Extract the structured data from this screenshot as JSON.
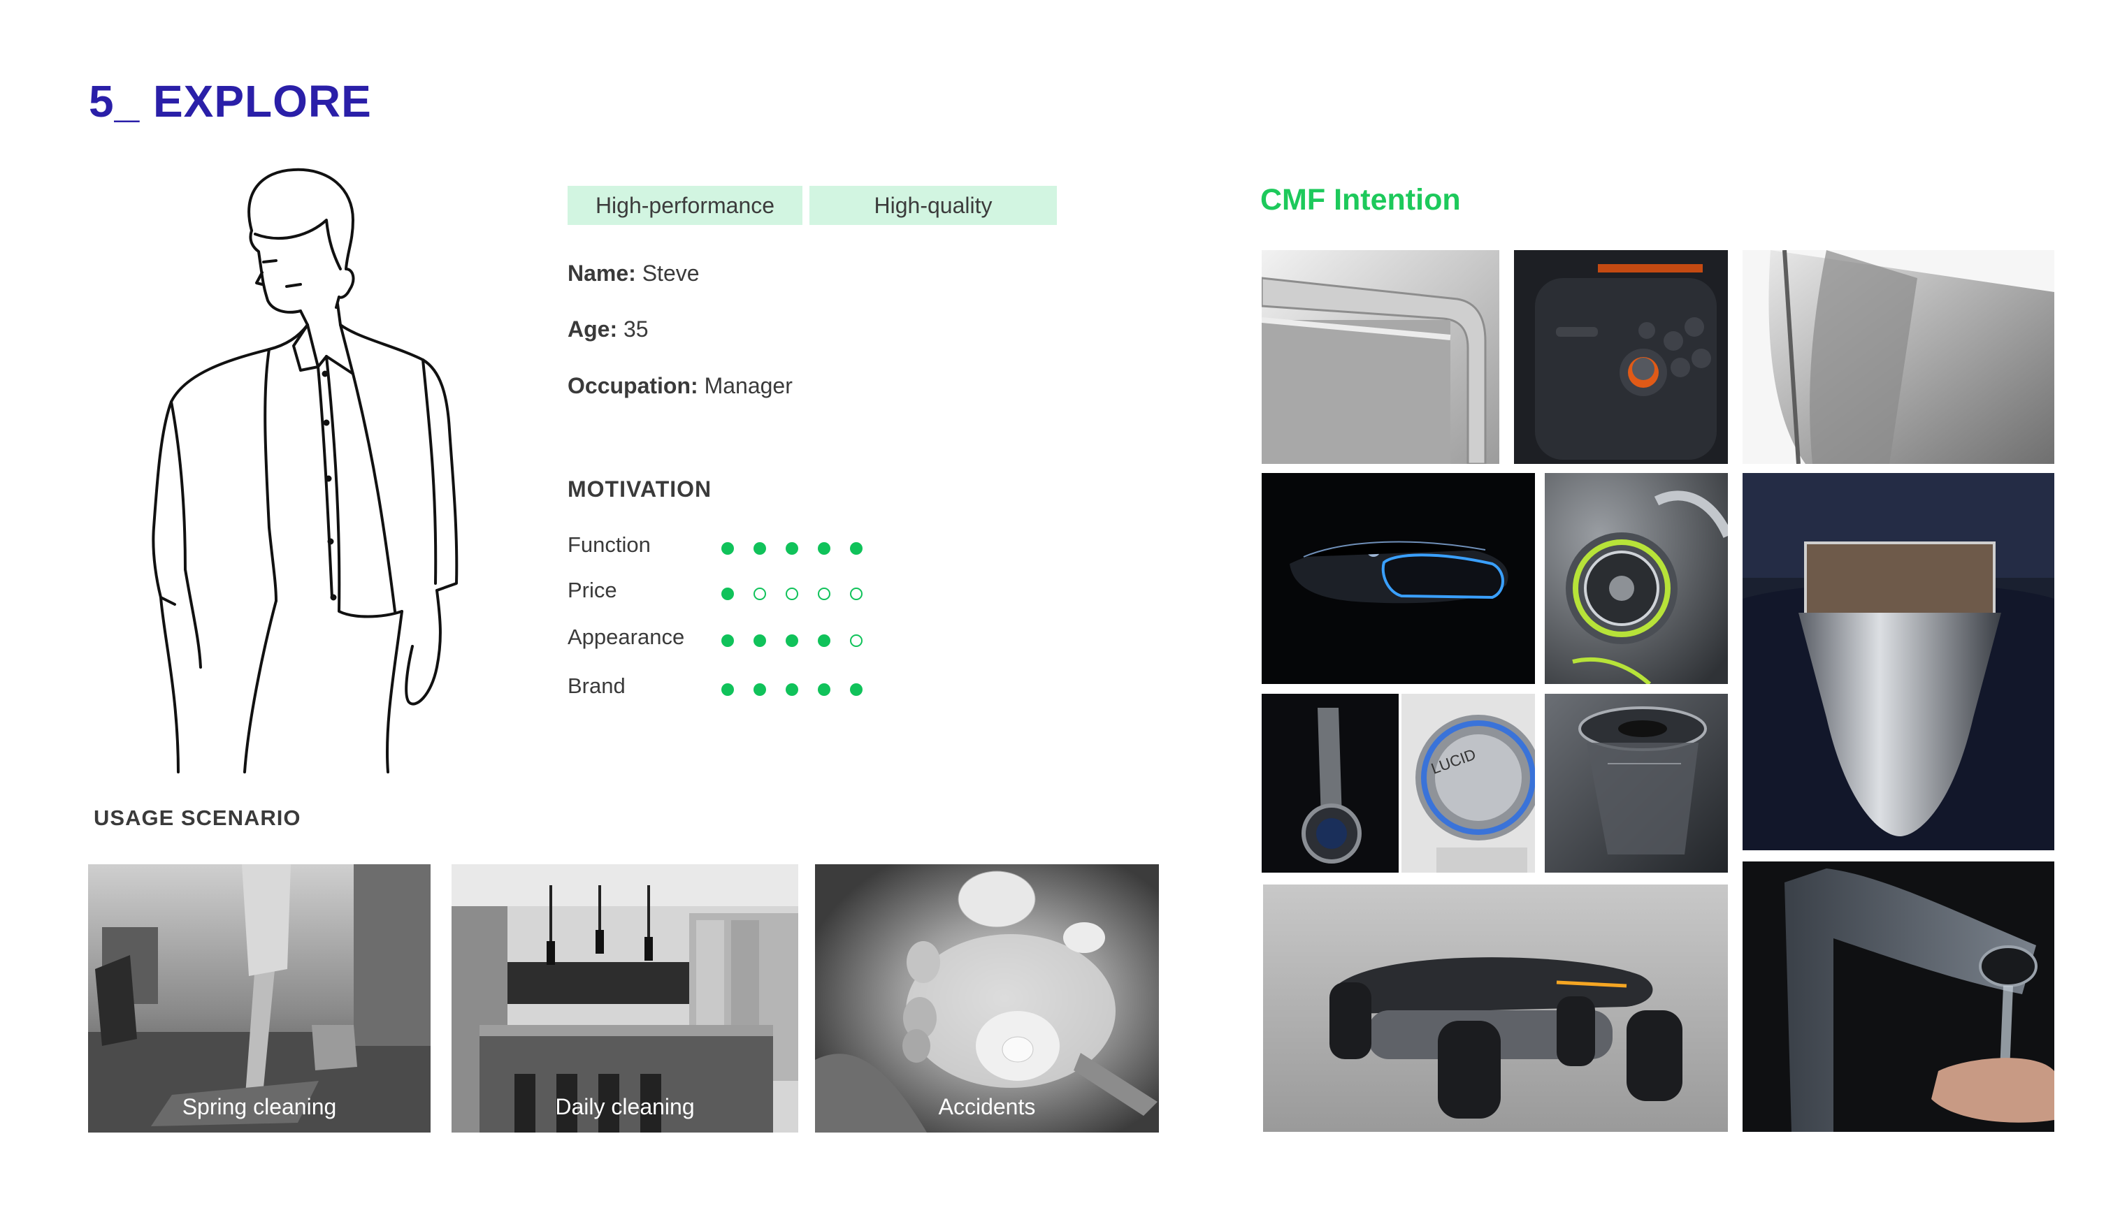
{
  "header": {
    "title": "5_ EXPLORE"
  },
  "persona": {
    "tags": [
      "High-performance",
      "High-quality"
    ],
    "name_label": "Name:",
    "name_value": "Steve",
    "age_label": "Age:",
    "age_value": "35",
    "occupation_label": "Occupation:",
    "occupation_value": "Manager"
  },
  "motivation": {
    "title": "MOTIVATION",
    "items": [
      {
        "label": "Function",
        "rating": 5,
        "max": 5
      },
      {
        "label": "Price",
        "rating": 1,
        "max": 5
      },
      {
        "label": "Appearance",
        "rating": 4,
        "max": 5
      },
      {
        "label": "Brand",
        "rating": 5,
        "max": 5
      }
    ]
  },
  "usage": {
    "title": "USAGE SCENARIO",
    "scenes": [
      {
        "label": "Spring cleaning"
      },
      {
        "label": "Daily cleaning"
      },
      {
        "label": "Accidents"
      }
    ]
  },
  "cmf": {
    "title": "CMF Intention"
  },
  "colors": {
    "title": "#2a1fa8",
    "accent_green": "#10c25a",
    "tag_bg": "#d2f5e1",
    "cmf_title": "#1dc95b"
  }
}
